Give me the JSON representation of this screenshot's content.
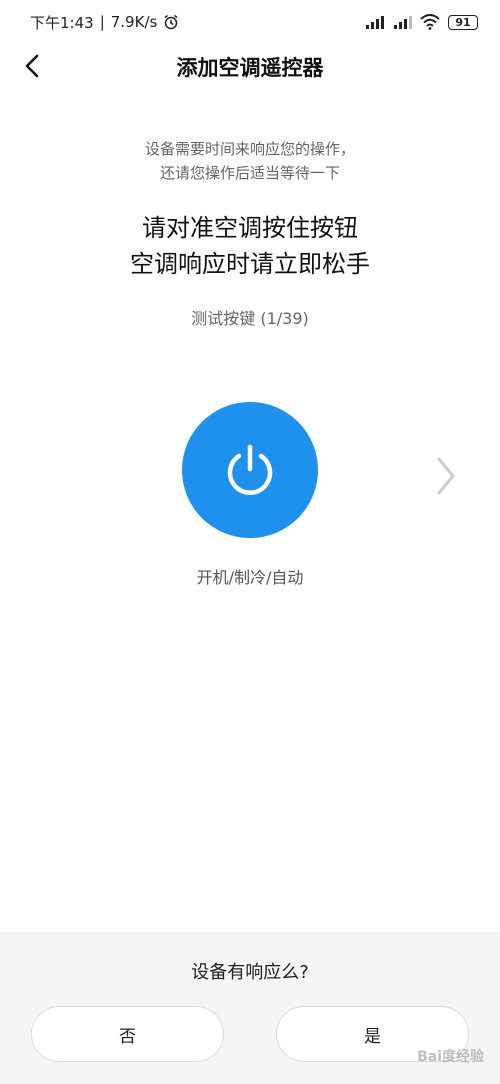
{
  "status_bar": {
    "time": "下午1:43",
    "net_speed": "7.9K/s",
    "battery": "91"
  },
  "header": {
    "title": "添加空调遥控器"
  },
  "content": {
    "hint_line1": "设备需要时间来响应您的操作，",
    "hint_line2": "还请您操作后适当等待一下",
    "instruction_line1": "请对准空调按住按钮",
    "instruction_line2": "空调响应时请立即松手",
    "counter": "测试按键 (1/39)",
    "power_icon": "power-icon",
    "power_color": "#1E90EE",
    "key_label": "开机/制冷/自动"
  },
  "bottom": {
    "question": "设备有响应么?",
    "no_label": "否",
    "yes_label": "是"
  },
  "watermark": "Bai度经验"
}
